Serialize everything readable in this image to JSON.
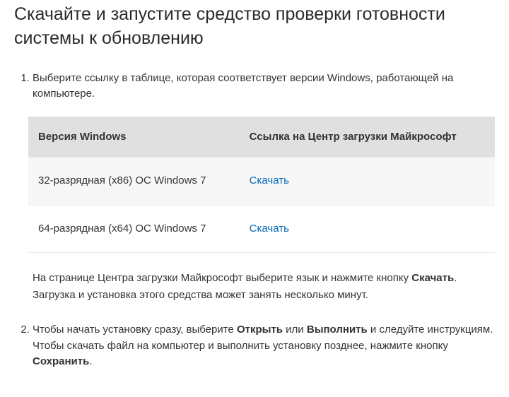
{
  "heading": "Скачайте и запустите средство проверки готовности системы к обновлению",
  "steps": {
    "step1": {
      "intro": "Выберите ссылку в таблице, которая соответствует версии Windows, работающей на компьютере.",
      "table": {
        "header_version": "Версия Windows",
        "header_link": "Ссылка на Центр загрузки Майкрософт",
        "rows": [
          {
            "version": "32-разрядная (x86) ОС Windows 7",
            "link_text": "Скачать"
          },
          {
            "version": "64-разрядная (x64) ОС Windows 7",
            "link_text": "Скачать"
          }
        ]
      },
      "note_a": "На странице Центра загрузки Майкрософт выберите язык и нажмите кнопку ",
      "note_b_bold": "Скачать",
      "note_c": ". Загрузка и установка этого средства может занять несколько минут."
    },
    "step2": {
      "p1": "Чтобы начать установку сразу, выберите ",
      "b1": "Открыть",
      "p2": " или ",
      "b2": "Выполнить",
      "p3": " и следуйте инструкциям. Чтобы скачать файл на компьютер и выполнить установку позднее, нажмите кнопку ",
      "b3": "Сохранить",
      "p4": "."
    }
  }
}
